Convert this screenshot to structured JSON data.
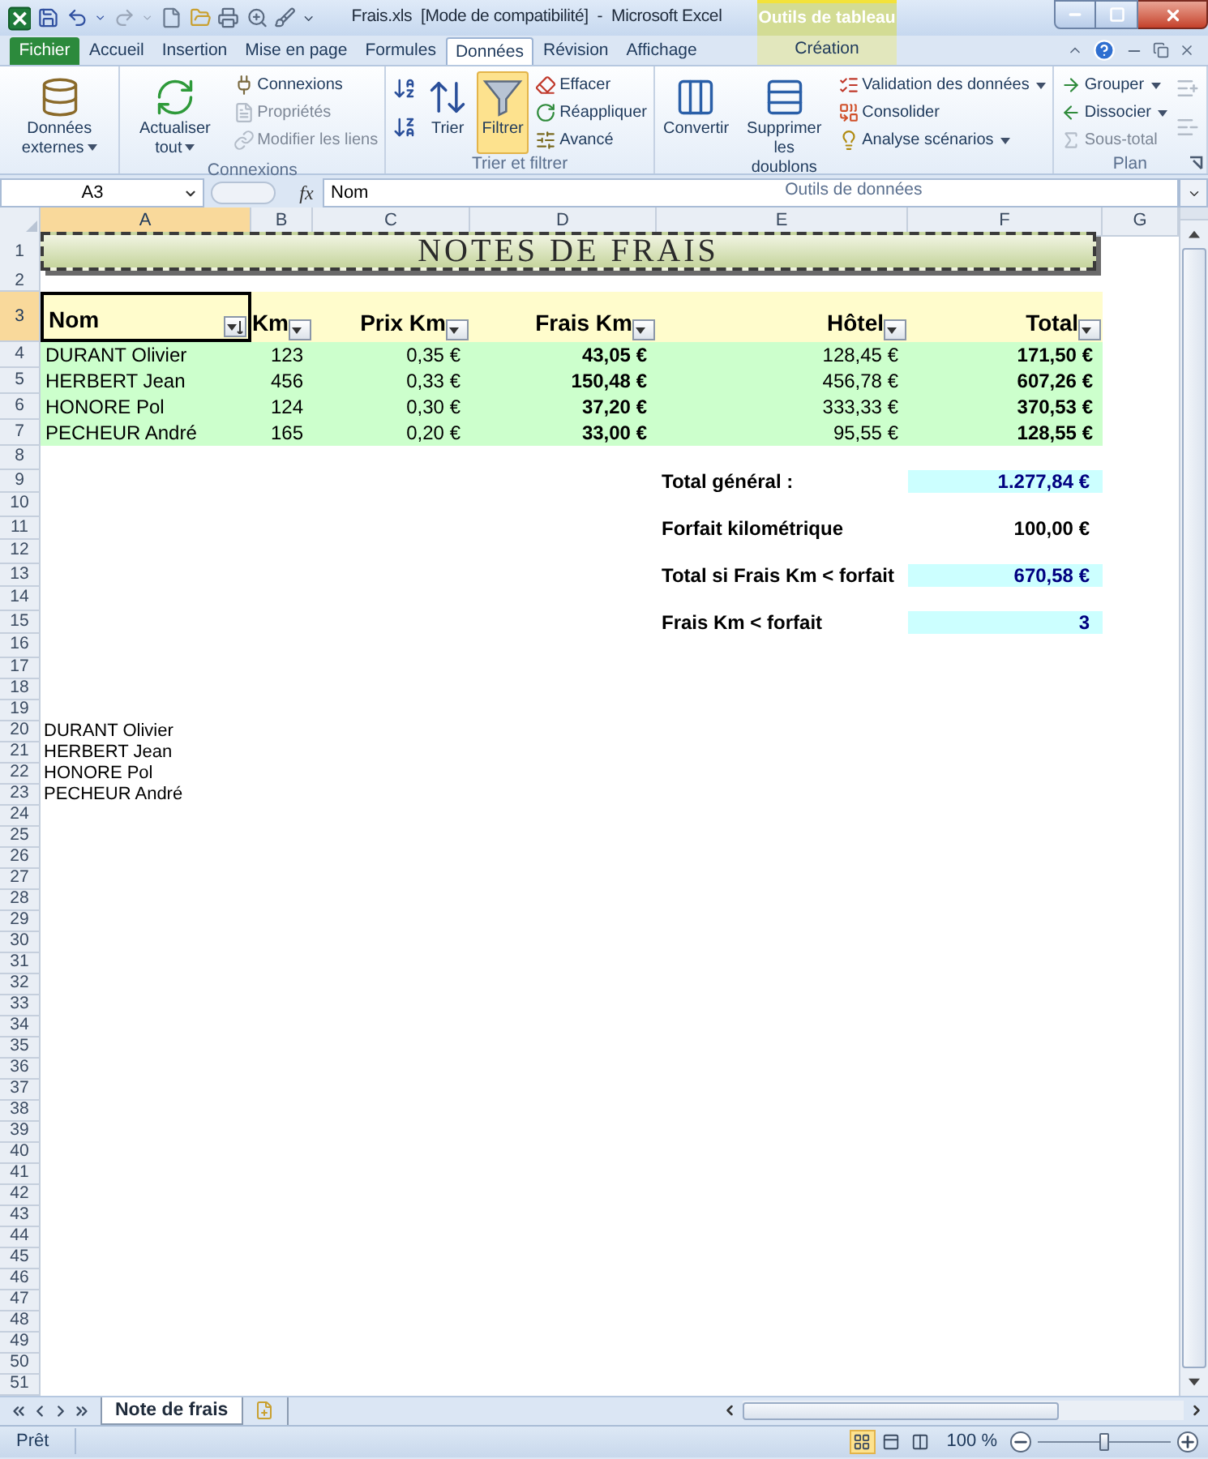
{
  "title_bar": {
    "title": "Frais.xls  [Mode de compatibilité]  -  Microsoft Excel",
    "contextual_group": "Outils de tableau"
  },
  "tabs": [
    {
      "label": "Fichier",
      "kind": "file",
      "selected": false
    },
    {
      "label": "Accueil",
      "kind": "normal",
      "selected": false
    },
    {
      "label": "Insertion",
      "kind": "normal",
      "selected": false
    },
    {
      "label": "Mise en page",
      "kind": "normal",
      "selected": false
    },
    {
      "label": "Formules",
      "kind": "normal",
      "selected": false
    },
    {
      "label": "Données",
      "kind": "normal",
      "selected": true
    },
    {
      "label": "Révision",
      "kind": "normal",
      "selected": false
    },
    {
      "label": "Affichage",
      "kind": "normal",
      "selected": false
    },
    {
      "label": "Création",
      "kind": "contextual",
      "selected": false
    }
  ],
  "ribbon": {
    "groups": [
      {
        "items": [
          {
            "label": "Données externes",
            "kind": "large",
            "dropdown": true,
            "disabled": false,
            "pressed": false
          }
        ]
      },
      {
        "label": "Connexions",
        "items": [
          {
            "label": "Actualiser tout",
            "kind": "large",
            "dropdown": true,
            "disabled": false,
            "pressed": false
          },
          {
            "label": "Connexions",
            "kind": "small",
            "dropdown": false,
            "disabled": false,
            "pressed": false
          },
          {
            "label": "Propriétés",
            "kind": "small",
            "dropdown": false,
            "disabled": true,
            "pressed": false
          },
          {
            "label": "Modifier les liens",
            "kind": "small",
            "dropdown": false,
            "disabled": true,
            "pressed": false
          }
        ]
      },
      {
        "label": "Trier et filtrer",
        "items": [
          {
            "kind": "icon",
            "disabled": false,
            "pressed": false
          },
          {
            "kind": "icon",
            "disabled": false,
            "pressed": false
          },
          {
            "label": "Trier",
            "kind": "large",
            "dropdown": false,
            "disabled": false,
            "pressed": false
          },
          {
            "label": "Filtrer",
            "kind": "large",
            "dropdown": false,
            "disabled": false,
            "pressed": true
          },
          {
            "label": "Effacer",
            "kind": "small",
            "dropdown": false,
            "disabled": false,
            "pressed": false
          },
          {
            "label": "Réappliquer",
            "kind": "small",
            "dropdown": false,
            "disabled": false,
            "pressed": false
          },
          {
            "label": "Avancé",
            "kind": "small",
            "dropdown": false,
            "disabled": false,
            "pressed": false
          }
        ]
      },
      {
        "label": "Outils de données",
        "items": [
          {
            "label": "Convertir",
            "kind": "large",
            "dropdown": false,
            "disabled": false,
            "pressed": false
          },
          {
            "label": "Supprimer les doublons",
            "kind": "large",
            "dropdown": false,
            "disabled": false,
            "pressed": false
          },
          {
            "label": "Validation des données",
            "kind": "small",
            "dropdown": true,
            "disabled": false,
            "pressed": false
          },
          {
            "label": "Consolider",
            "kind": "small",
            "dropdown": false,
            "disabled": false,
            "pressed": false
          },
          {
            "label": "Analyse scénarios",
            "kind": "small",
            "dropdown": true,
            "disabled": false,
            "pressed": false
          }
        ]
      },
      {
        "label": "Plan",
        "launcher": true,
        "items": [
          {
            "label": "Grouper",
            "kind": "small",
            "dropdown": true,
            "disabled": false,
            "pressed": false
          },
          {
            "label": "Dissocier",
            "kind": "small",
            "dropdown": true,
            "disabled": false,
            "pressed": false
          },
          {
            "label": "Sous-total",
            "kind": "small",
            "dropdown": false,
            "disabled": true,
            "pressed": false
          },
          {
            "kind": "icon",
            "disabled": true,
            "pressed": false
          },
          {
            "kind": "icon",
            "disabled": true,
            "pressed": false
          }
        ]
      }
    ]
  },
  "formula_bar": {
    "name_box": "A3",
    "function_label": "fx",
    "formula": "Nom"
  },
  "columns": [
    {
      "label": "A",
      "selected": true
    },
    {
      "label": "B",
      "selected": false
    },
    {
      "label": "C",
      "selected": false
    },
    {
      "label": "D",
      "selected": false
    },
    {
      "label": "E",
      "selected": false
    },
    {
      "label": "F",
      "selected": false
    },
    {
      "label": "G",
      "selected": false
    }
  ],
  "rows": [
    {
      "label": "1",
      "selected": false
    },
    {
      "label": "2",
      "selected": false
    },
    {
      "label": "3",
      "selected": true
    },
    {
      "label": "4",
      "selected": false
    },
    {
      "label": "5",
      "selected": false
    },
    {
      "label": "6",
      "selected": false
    },
    {
      "label": "7",
      "selected": false
    },
    {
      "label": "8",
      "selected": false
    },
    {
      "label": "9",
      "selected": false
    },
    {
      "label": "10",
      "selected": false
    },
    {
      "label": "11",
      "selected": false
    },
    {
      "label": "12",
      "selected": false
    },
    {
      "label": "13",
      "selected": false
    },
    {
      "label": "14",
      "selected": false
    },
    {
      "label": "15",
      "selected": false
    },
    {
      "label": "16",
      "selected": false
    },
    {
      "label": "17",
      "selected": false
    },
    {
      "label": "18",
      "selected": false
    },
    {
      "label": "19",
      "selected": false
    },
    {
      "label": "20",
      "selected": false
    },
    {
      "label": "21",
      "selected": false
    },
    {
      "label": "22",
      "selected": false
    },
    {
      "label": "23",
      "selected": false
    },
    {
      "label": "24",
      "selected": false
    },
    {
      "label": "25",
      "selected": false
    },
    {
      "label": "26",
      "selected": false
    },
    {
      "label": "27",
      "selected": false
    },
    {
      "label": "28",
      "selected": false
    },
    {
      "label": "29",
      "selected": false
    },
    {
      "label": "30",
      "selected": false
    },
    {
      "label": "31",
      "selected": false
    },
    {
      "label": "32",
      "selected": false
    },
    {
      "label": "33",
      "selected": false
    },
    {
      "label": "34",
      "selected": false
    },
    {
      "label": "35",
      "selected": false
    },
    {
      "label": "36",
      "selected": false
    },
    {
      "label": "37",
      "selected": false
    },
    {
      "label": "38",
      "selected": false
    },
    {
      "label": "39",
      "selected": false
    },
    {
      "label": "40",
      "selected": false
    },
    {
      "label": "41",
      "selected": false
    },
    {
      "label": "42",
      "selected": false
    },
    {
      "label": "43",
      "selected": false
    },
    {
      "label": "44",
      "selected": false
    },
    {
      "label": "45",
      "selected": false
    },
    {
      "label": "46",
      "selected": false
    },
    {
      "label": "47",
      "selected": false
    },
    {
      "label": "48",
      "selected": false
    },
    {
      "label": "49",
      "selected": false
    },
    {
      "label": "50",
      "selected": false
    },
    {
      "label": "51",
      "selected": false
    }
  ],
  "sheet": {
    "title": "NOTES DE FRAIS",
    "table": {
      "headers": [
        {
          "label": "Nom",
          "sorted": true,
          "selected": true
        },
        {
          "label": "Km",
          "sorted": false,
          "selected": false
        },
        {
          "label": "Prix Km",
          "sorted": false,
          "selected": false
        },
        {
          "label": "Frais Km",
          "sorted": false,
          "selected": false
        },
        {
          "label": "Hôtel",
          "sorted": false,
          "selected": false
        },
        {
          "label": "Total",
          "sorted": false,
          "selected": false
        }
      ],
      "rows": [
        [
          "DURANT Olivier",
          "123",
          "0,35 €",
          "43,05 €",
          "128,45 €",
          "171,50 €"
        ],
        [
          "HERBERT Jean",
          "456",
          "0,33 €",
          "150,48 €",
          "456,78 €",
          "607,26 €"
        ],
        [
          "HONORE Pol",
          "124",
          "0,30 €",
          "37,20 €",
          "333,33 €",
          "370,53 €"
        ],
        [
          "PECHEUR André",
          "165",
          "0,20 €",
          "33,00 €",
          "95,55 €",
          "128,55 €"
        ]
      ]
    },
    "summary": [
      {
        "label": "Total général :",
        "value": "1.277,84 €",
        "highlighted": true
      },
      {
        "label": "Forfait kilométrique",
        "value": "100,00 €",
        "highlighted": false
      },
      {
        "label": "Total si Frais Km < forfait",
        "value": "670,58 €",
        "highlighted": true
      },
      {
        "label": "Frais Km < forfait",
        "value": "3",
        "highlighted": true
      }
    ],
    "names": [
      "DURANT Olivier",
      "HERBERT Jean",
      "HONORE Pol",
      "PECHEUR André"
    ]
  },
  "sheet_tabs": [
    {
      "label": "Note de frais",
      "selected": true
    }
  ],
  "status_bar": {
    "status": "Prêt",
    "views": [
      {
        "kind": "normal",
        "selected": true
      },
      {
        "kind": "page_layout",
        "selected": false
      },
      {
        "kind": "page_break",
        "selected": false
      }
    ],
    "zoom": "100 %",
    "zoom_slider": {
      "level": 0.5
    }
  }
}
